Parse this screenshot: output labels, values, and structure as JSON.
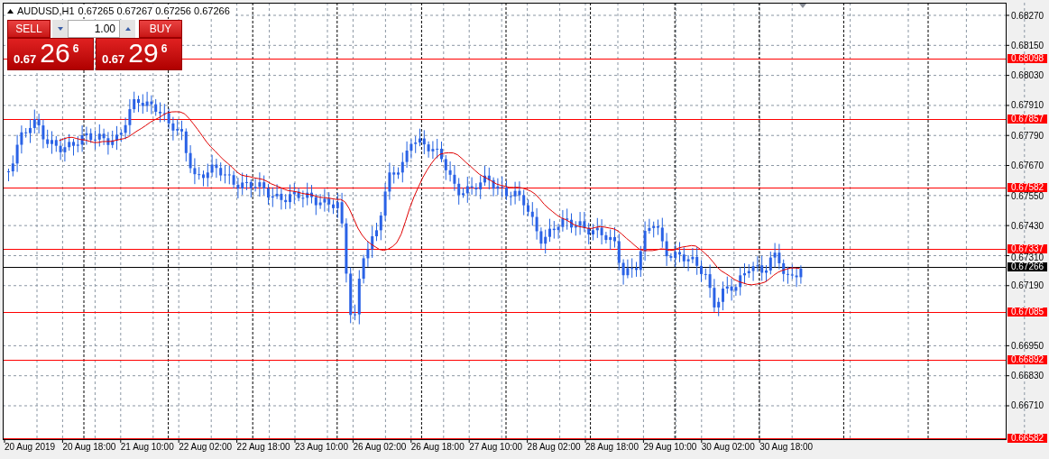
{
  "header": {
    "symbol": "AUDUSD,H1",
    "ohlc": "0.67265 0.67267 0.67256 0.67266"
  },
  "trade_panel": {
    "sell_label": "SELL",
    "buy_label": "BUY",
    "lot": "1.00",
    "sell_price": {
      "prefix": "0.67",
      "big": "26",
      "sup": "6"
    },
    "buy_price": {
      "prefix": "0.67",
      "big": "29",
      "sup": "6"
    }
  },
  "price_axis": {
    "ticks": [
      "0.68270",
      "0.68150",
      "0.68030",
      "0.67910",
      "0.67790",
      "0.67670",
      "0.67550",
      "0.67430",
      "0.67310",
      "0.67190",
      "0.66950",
      "0.66830",
      "0.66710"
    ]
  },
  "price_levels": [
    {
      "label": "0.68098",
      "color": "#ff0000"
    },
    {
      "label": "0.67857",
      "color": "#ff0000"
    },
    {
      "label": "0.67582",
      "color": "#ff0000"
    },
    {
      "label": "0.67337",
      "color": "#ff0000"
    },
    {
      "label": "0.67266",
      "color": "#000000"
    },
    {
      "label": "0.67085",
      "color": "#ff0000"
    },
    {
      "label": "0.66892",
      "color": "#ff0000"
    },
    {
      "label": "0.66582",
      "color": "#ff0000"
    }
  ],
  "time_axis": {
    "labels": [
      "20 Aug 2019",
      "20 Aug 18:00",
      "21 Aug 10:00",
      "22 Aug 02:00",
      "22 Aug 18:00",
      "23 Aug 10:00",
      "26 Aug 02:00",
      "26 Aug 18:00",
      "27 Aug 10:00",
      "28 Aug 02:00",
      "28 Aug 18:00",
      "29 Aug 10:00",
      "30 Aug 02:00",
      "30 Aug 18:00"
    ]
  }
}
